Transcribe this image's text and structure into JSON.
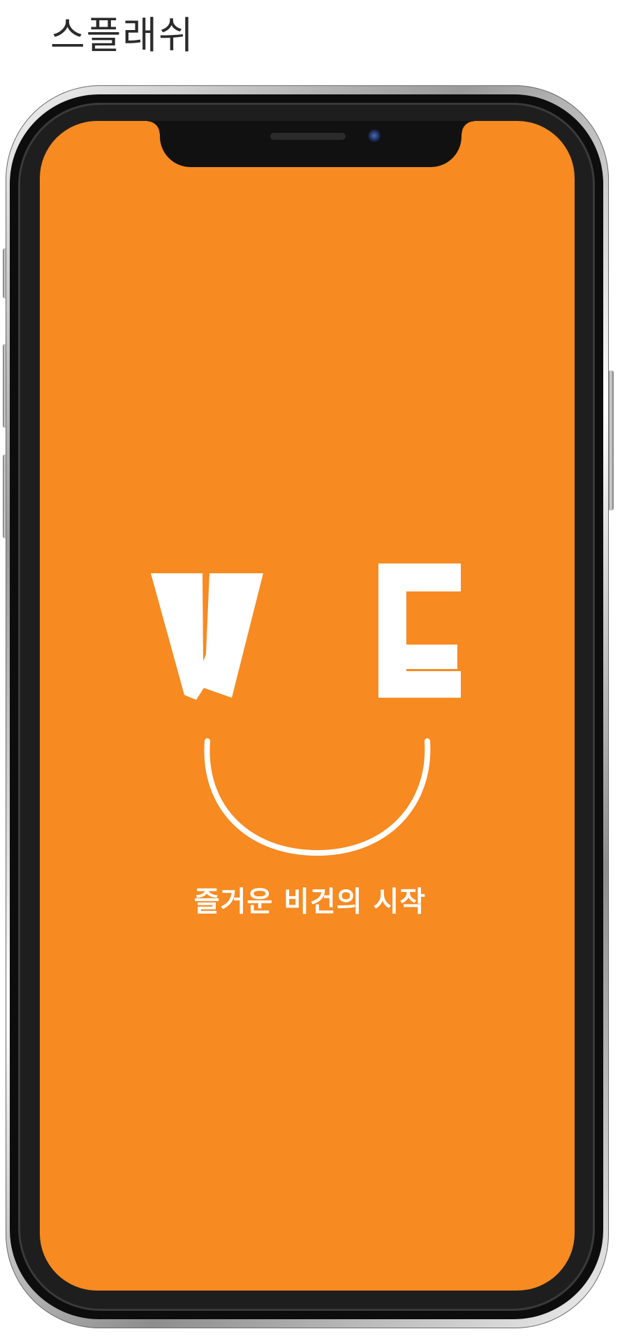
{
  "page": {
    "title": "스플래쉬"
  },
  "splash": {
    "background_color": "#F78A21",
    "logo_letters": [
      "V",
      "E"
    ],
    "logo_color": "#FFFFFF",
    "tagline": "즐거운 비건의 시작"
  },
  "device": {
    "model": "phone-with-notch",
    "notch_icons": [
      "speaker-grille",
      "front-camera"
    ]
  }
}
